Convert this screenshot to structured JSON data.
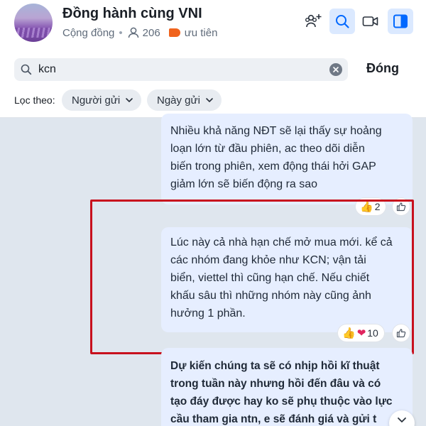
{
  "header": {
    "title": "Đồng hành cùng VNI",
    "community_label": "Cộng đồng",
    "member_count": "206",
    "priority_label": "ưu tiên"
  },
  "search": {
    "value": "kcn",
    "close_label": "Đóng"
  },
  "filters": {
    "label": "Lọc theo:",
    "sender_label": "Người gửi",
    "date_label": "Ngày gửi"
  },
  "messages": [
    {
      "lines": [
        "Nhiều khả năng NĐT sẽ lại thấy sự hoảng",
        "loạn lớn từ đầu phiên, ac theo dõi diễn",
        "biến trong phiên, xem động thái hởi GAP",
        "giảm lớn sẽ biến động ra sao"
      ],
      "reaction_count": "2"
    },
    {
      "lines": [
        "Lúc này cả nhà hạn chế mở mua mới. kể cả",
        "các nhóm đang khỏe như KCN; vận tải",
        "biển, viettel thì cũng hạn chế. Nếu chiết",
        "khấu sâu thì những nhóm này cũng ảnh",
        "hưởng 1 phần."
      ],
      "reaction_count": "10"
    },
    {
      "lines": [
        "Dự kiến chúng ta sẽ có nhịp hồi kĩ thuật",
        "trong tuần này nhưng hồi đến đâu và có",
        "tạo đáy được hay ko sẽ phụ thuộc vào lực",
        "cầu tham gia ntn, e sẽ đánh giá và gửi t"
      ]
    }
  ],
  "colors": {
    "accent": "#0068ff",
    "highlight_border": "#c8101d",
    "bubble_bg": "#e6eeff",
    "priority_tag": "#f0631d"
  }
}
